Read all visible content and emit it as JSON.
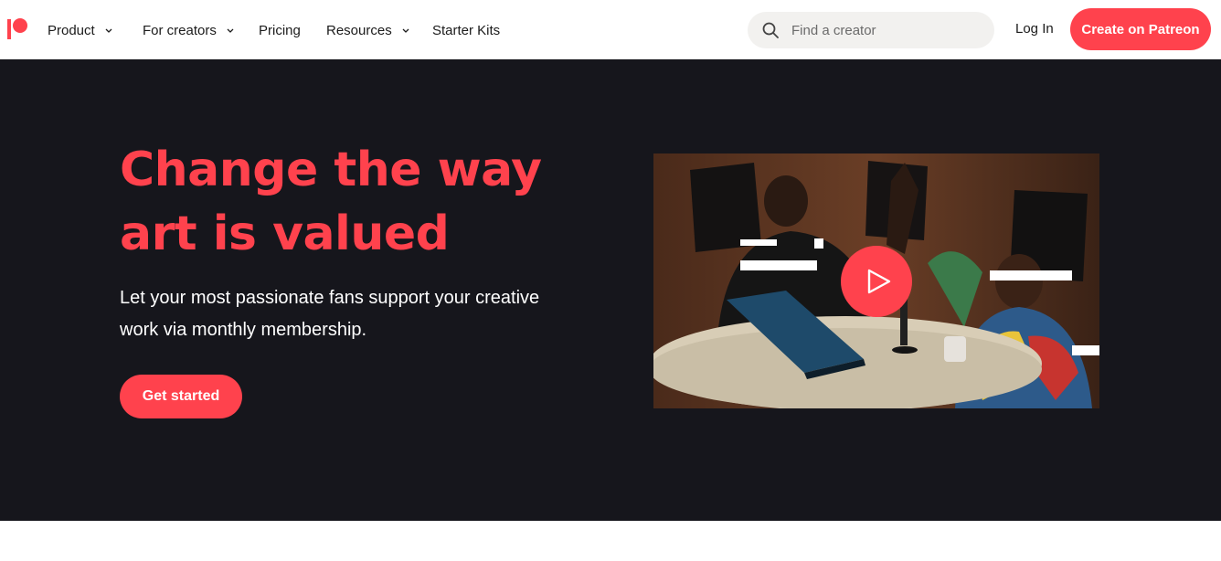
{
  "nav": {
    "items": [
      {
        "label": "Product",
        "has_dropdown": true
      },
      {
        "label": "For creators",
        "has_dropdown": true
      },
      {
        "label": "Pricing",
        "has_dropdown": false
      },
      {
        "label": "Resources",
        "has_dropdown": true
      },
      {
        "label": "Starter Kits",
        "has_dropdown": false
      }
    ],
    "search_placeholder": "Find a creator",
    "login_label": "Log In",
    "create_label": "Create on Patreon"
  },
  "hero": {
    "title_line1": "Change the way",
    "title_line2": "art is valued",
    "subtitle_line1": "Let your most passionate fans support your creative",
    "subtitle_line2": "work via monthly membership.",
    "cta_label": "Get started"
  },
  "icons": {
    "logo": "patreon-logo",
    "search": "search-icon",
    "chevron": "chevron-down-icon",
    "play": "play-icon"
  },
  "colors": {
    "brand": "#ff424d",
    "hero_bg": "#16161c",
    "text_dark": "#1b1b1b",
    "search_bg": "#f2f1ef"
  }
}
